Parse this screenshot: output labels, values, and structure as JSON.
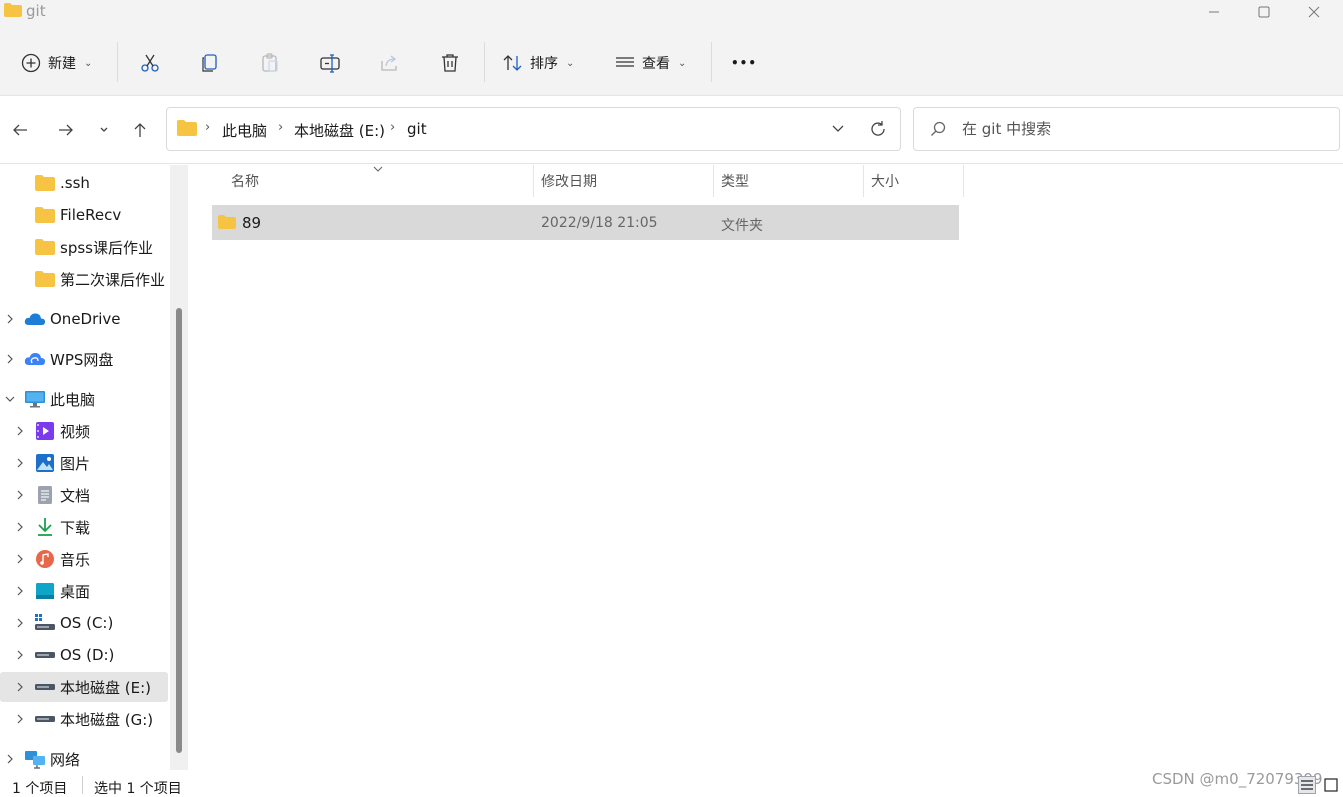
{
  "window": {
    "title": "git"
  },
  "toolbar": {
    "new_label": "新建",
    "sort_label": "排序",
    "view_label": "查看",
    "more_label": "•••"
  },
  "address": {
    "crumbs": [
      "此电脑",
      "本地磁盘 (E:)",
      "git"
    ]
  },
  "search": {
    "placeholder": "在 git 中搜索"
  },
  "sidebar": {
    "items": [
      {
        "label": ".ssh"
      },
      {
        "label": "FileRecv"
      },
      {
        "label": "spss课后作业"
      },
      {
        "label": "第二次课后作业"
      },
      {
        "label": "OneDrive"
      },
      {
        "label": "WPS网盘"
      },
      {
        "label": "此电脑"
      },
      {
        "label": "视频"
      },
      {
        "label": "图片"
      },
      {
        "label": "文档"
      },
      {
        "label": "下载"
      },
      {
        "label": "音乐"
      },
      {
        "label": "桌面"
      },
      {
        "label": "OS (C:)"
      },
      {
        "label": "OS (D:)"
      },
      {
        "label": "本地磁盘 (E:)"
      },
      {
        "label": "本地磁盘 (G:)"
      },
      {
        "label": "网络"
      }
    ]
  },
  "columns": {
    "name": "名称",
    "modified": "修改日期",
    "type": "类型",
    "size": "大小"
  },
  "files": [
    {
      "name": "89",
      "modified": "2022/9/18 21:05",
      "type": "文件夹",
      "size": ""
    }
  ],
  "status": {
    "item_count": "1 个项目",
    "selected": "选中 1 个项目",
    "watermark": "CSDN @m0_72079399"
  },
  "colors": {
    "folder": "#f6c343",
    "selection": "#d9d9d9",
    "onedrive": "#1c7ed6"
  }
}
